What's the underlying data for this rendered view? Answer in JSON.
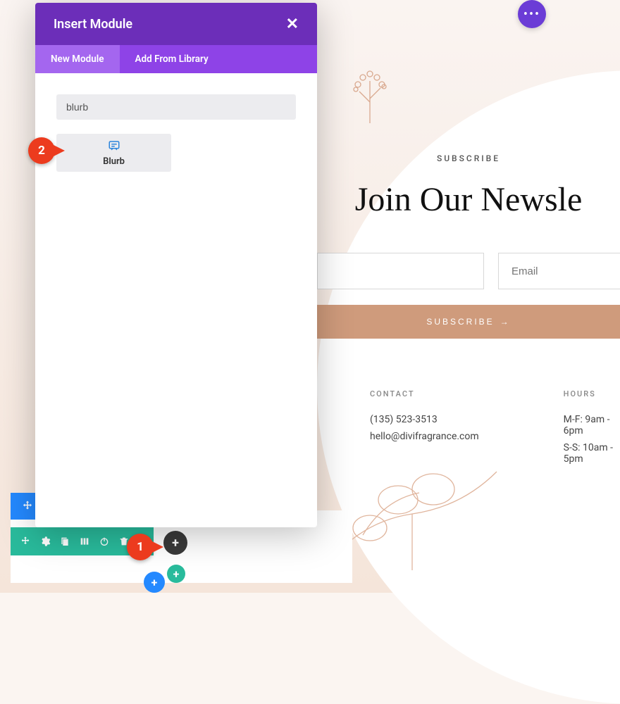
{
  "top_menu": {
    "glyph": "•••"
  },
  "panel": {
    "title": "Insert Module",
    "close": "✕",
    "tabs": {
      "new": "New Module",
      "library": "Add From Library"
    },
    "search_value": "blurb",
    "module": {
      "label": "Blurb"
    }
  },
  "callouts": {
    "one": "1",
    "two": "2"
  },
  "newsletter": {
    "eyebrow": "SUBSCRIBE",
    "title": "Join Our Newsle",
    "name_placeholder": "",
    "email_placeholder": "Email",
    "button": "SUBSCRIBE",
    "arrow": "→"
  },
  "contact": {
    "heading": "CONTACT",
    "phone": "(135) 523-3513",
    "email": "hello@divifragrance.com"
  },
  "hours": {
    "heading": "HOURS",
    "line1": "M-F: 9am - 6pm",
    "line2": "S-S: 10am - 5pm"
  },
  "plus": "+"
}
